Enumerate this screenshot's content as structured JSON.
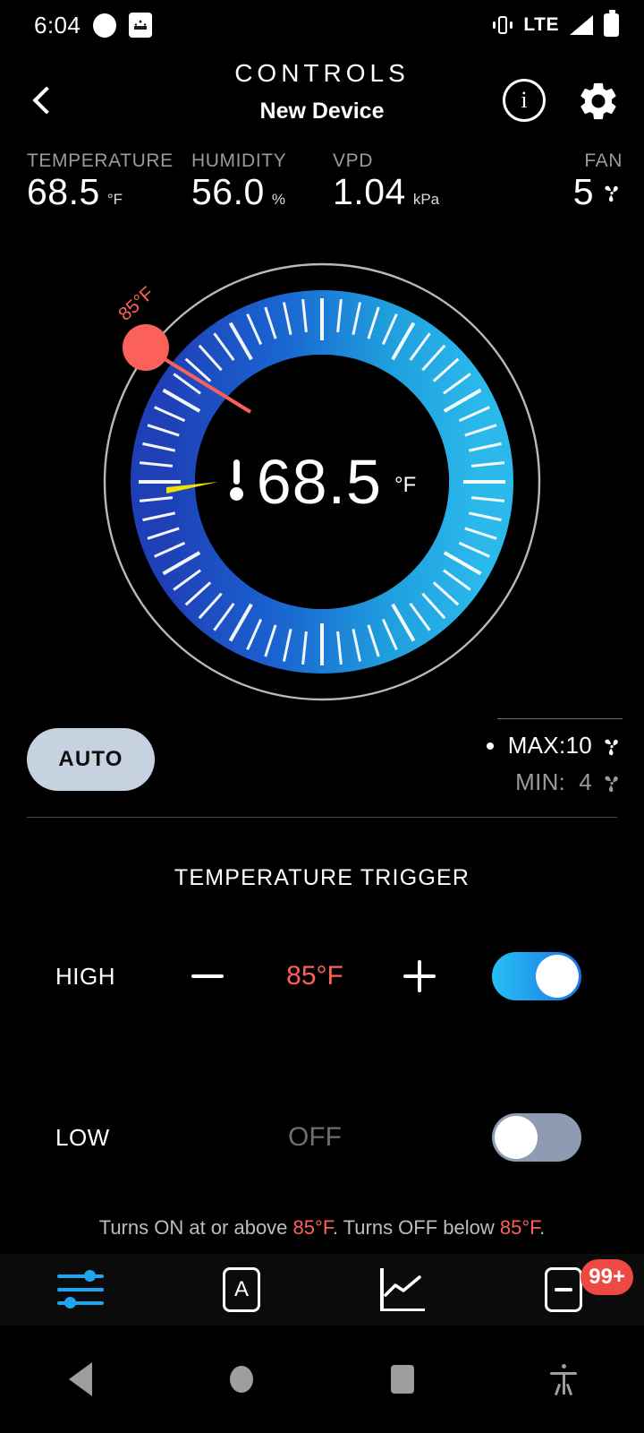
{
  "status_bar": {
    "time": "6:04",
    "network": "LTE",
    "icons": [
      "circle-icon",
      "app-badge-icon",
      "vibrate-icon",
      "signal-icon",
      "battery-icon"
    ]
  },
  "header": {
    "title": "CONTROLS",
    "subtitle": "New Device",
    "back_icon": "chevron-left-icon",
    "info_icon": "info-icon",
    "info_glyph": "i",
    "settings_icon": "gear-icon"
  },
  "metrics": [
    {
      "label": "TEMPERATURE",
      "value": "68.5",
      "unit": "°F"
    },
    {
      "label": "HUMIDITY",
      "value": "56.0",
      "unit": "%"
    },
    {
      "label": "VPD",
      "value": "1.04",
      "unit": "kPa"
    },
    {
      "label": "FAN",
      "value": "5",
      "unit": ""
    }
  ],
  "dial": {
    "value": "68.5",
    "unit": "°F",
    "thermometer_icon": "thermometer-icon",
    "knob_label": "85°F",
    "knob_color": "#fb6159",
    "gradient_start": "#1a3fb8",
    "gradient_end": "#26b6ea",
    "setpoint_marker_color": "#f2e000",
    "ring_color": "#b9b9b9",
    "tick_count": 60
  },
  "mode": {
    "auto_label": "AUTO",
    "auto_bg": "#c6d2e0"
  },
  "fan_limits": {
    "max_label": "MAX:10",
    "min_label": "MIN:  4",
    "fan_icon": "fan-icon"
  },
  "trigger": {
    "section_title": "TEMPERATURE TRIGGER",
    "rows": [
      {
        "label": "HIGH",
        "value": "85°F",
        "state": "on",
        "minus": "−",
        "plus": "+",
        "toggle_on": true
      },
      {
        "label": "LOW",
        "value": "OFF",
        "state": "off",
        "minus": "−",
        "plus": "+",
        "toggle_on": false
      }
    ],
    "footnote_pre": "Turns ON at or above ",
    "footnote_hot1": "85°F",
    "footnote_mid": ". Turns OFF below ",
    "footnote_hot2": "85°F",
    "footnote_end": "."
  },
  "tabbar": {
    "items": [
      {
        "name": "controls-tab",
        "icon": "sliders-icon",
        "active": true
      },
      {
        "name": "auto-tab",
        "icon": "auto-a-icon",
        "glyph": "A",
        "active": false
      },
      {
        "name": "chart-tab",
        "icon": "line-chart-icon",
        "active": false
      },
      {
        "name": "notes-tab",
        "icon": "note-icon",
        "badge": "99+",
        "active": false
      }
    ],
    "badge_color": "#ed4a43",
    "active_color": "#1ea7f0"
  },
  "android_nav": {
    "back": "back-triangle-icon",
    "home": "home-circle-icon",
    "recents": "recents-square-icon",
    "accessibility": "accessibility-icon"
  }
}
